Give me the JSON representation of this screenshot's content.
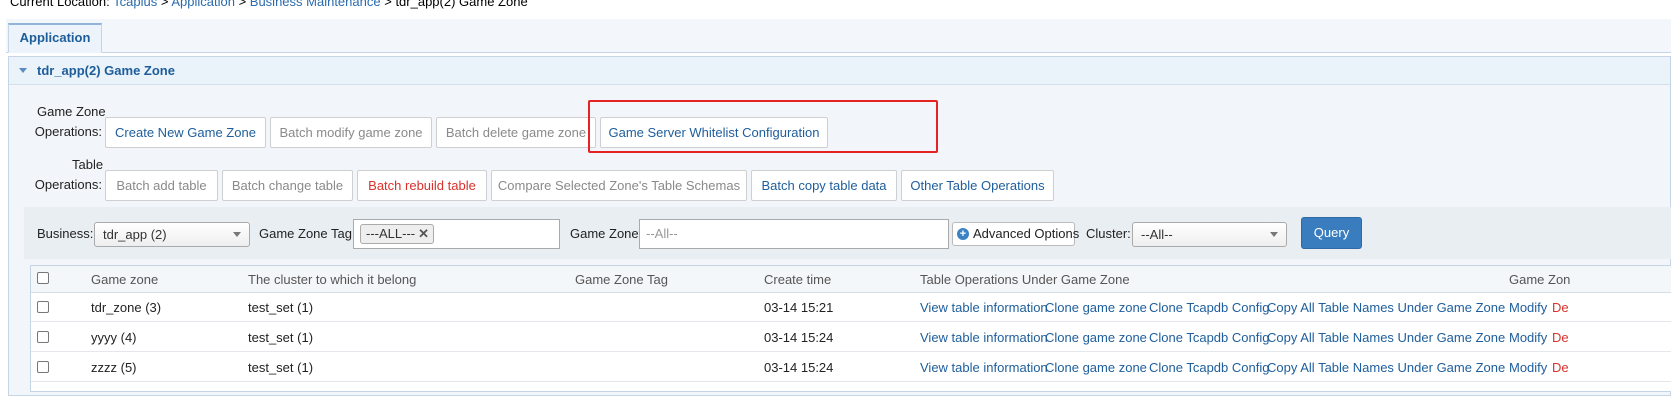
{
  "breadcrumb": {
    "prefix": "Current Location:",
    "items": [
      "Tcaplus",
      "Application",
      "Business Maintenance"
    ],
    "separator": ">",
    "current": "tdr_app(2) Game Zone"
  },
  "tabs": [
    {
      "label": "Application",
      "active": true
    }
  ],
  "panel": {
    "title": "tdr_app(2) Game Zone"
  },
  "game_zone_operations": {
    "label_line1": "Game Zone",
    "label_line2": "Operations:",
    "buttons": [
      {
        "label": "Create New Game Zone",
        "state": "enabled"
      },
      {
        "label": "Batch modify game zone",
        "state": "disabled"
      },
      {
        "label": "Batch delete game zone",
        "state": "disabled"
      },
      {
        "label": "Game Server Whitelist Configuration",
        "state": "enabled",
        "highlighted": true
      }
    ]
  },
  "table_operations": {
    "label_line1": "Table",
    "label_line2": "Operations:",
    "buttons": [
      {
        "label": "Batch add table",
        "state": "disabled"
      },
      {
        "label": "Batch change table",
        "state": "disabled"
      },
      {
        "label": "Batch rebuild table",
        "state": "danger"
      },
      {
        "label": "Compare Selected Zone's Table Schemas",
        "state": "disabled"
      },
      {
        "label": "Batch copy table data",
        "state": "enabled"
      },
      {
        "label": "Other Table Operations",
        "state": "enabled"
      }
    ]
  },
  "filters": {
    "business_label": "Business:",
    "business_value": "tdr_app (2)",
    "tag_label": "Game Zone Tag:",
    "tag_chip": "---ALL---",
    "zone_label": "Game Zone:",
    "zone_placeholder": "--All--",
    "advanced_label": "Advanced Options",
    "cluster_label": "Cluster:",
    "cluster_value": "--All--",
    "query_label": "Query"
  },
  "table": {
    "columns": [
      "Game zone",
      "The cluster to which it belong",
      "Game Zone Tag",
      "Create time",
      "Table Operations Under Game Zone",
      "Game Zon"
    ],
    "rows": [
      {
        "zone": "tdr_zone (3)",
        "cluster": "test_set (1)",
        "tag": "",
        "time": "03-14 15:21"
      },
      {
        "zone": "yyyy (4)",
        "cluster": "test_set (1)",
        "tag": "",
        "time": "03-14 15:24"
      },
      {
        "zone": "zzzz (5)",
        "cluster": "test_set (1)",
        "tag": "",
        "time": "03-14 15:24"
      }
    ],
    "row_actions": {
      "view": "View table information",
      "clone_zone": "Clone game zone",
      "clone_cfg": "Clone Tcapdb Config",
      "copy_names": "Copy All Table Names Under Game Zone",
      "modify": "Modify",
      "delete": "De"
    }
  },
  "colors": {
    "link": "#1e5e9c",
    "danger": "#d9322a",
    "primary": "#3a7dbf",
    "highlight_box": "#e52323"
  }
}
